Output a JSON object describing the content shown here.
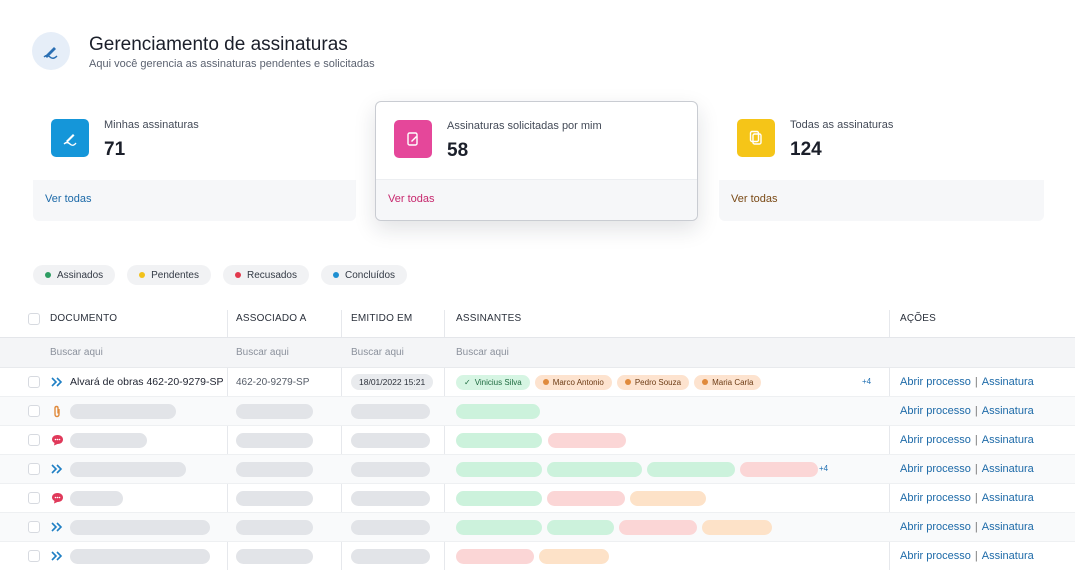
{
  "header": {
    "title": "Gerenciamento de assinaturas",
    "subtitle": "Aqui você gerencia as assinaturas pendentes e solicitadas",
    "icon": "signature-icon"
  },
  "cards": [
    {
      "label": "Minhas assinaturas",
      "value": "71",
      "link": "Ver todas",
      "color": "#1596d9",
      "link_color": "#1d6aa8",
      "icon": "signature-pen-icon"
    },
    {
      "label": "Assinaturas solicitadas por mim",
      "value": "58",
      "link": "Ver todas",
      "color": "#e5479a",
      "link_color": "#c7286e",
      "icon": "document-edit-icon"
    },
    {
      "label": "Todas as assinaturas",
      "value": "124",
      "link": "Ver todas",
      "color": "#f5c518",
      "link_color": "#7a4a16",
      "icon": "documents-copy-icon"
    }
  ],
  "legend": [
    {
      "label": "Assinados",
      "color": "#2e9d63"
    },
    {
      "label": "Pendentes",
      "color": "#f2c21b"
    },
    {
      "label": "Recusados",
      "color": "#e2394d"
    },
    {
      "label": "Concluídos",
      "color": "#1f8fd1"
    }
  ],
  "table": {
    "columns": {
      "doc": "DOCUMENTO",
      "assoc": "ASSOCIADO A",
      "emit": "EMITIDO EM",
      "signers": "ASSINANTES",
      "actions": "AÇÕES"
    },
    "search_placeholder": "Buscar aqui",
    "first_row": {
      "document": "Alvará de obras 462-20-9279-SP",
      "associated": "462-20-9279-SP",
      "issued": "18/01/2022 15:21",
      "signers": [
        {
          "name": "Vinicius Silva",
          "status": "signed"
        },
        {
          "name": "Marco Antonio",
          "status": "pending"
        },
        {
          "name": "Pedro Souza",
          "status": "pending"
        },
        {
          "name": "Maria Carla",
          "status": "pending"
        }
      ],
      "more": "+4"
    },
    "row4_more": "+4",
    "action_open": "Abrir processo",
    "action_sep": "|",
    "action_sign": "Assinatura"
  }
}
